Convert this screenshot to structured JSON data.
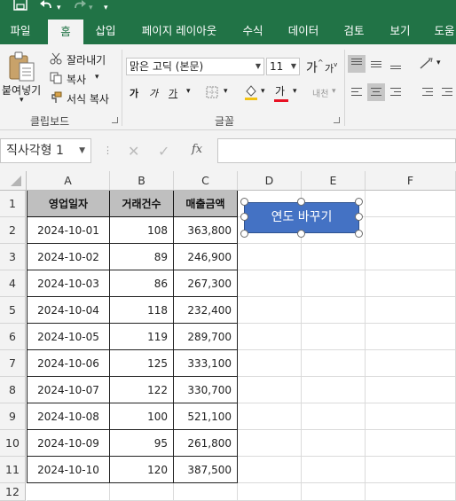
{
  "quick_access": {
    "save_icon": "save-icon",
    "undo_icon": "undo-icon",
    "redo_icon": "redo-icon",
    "customize_icon": "customize-quick-access-icon"
  },
  "tabs": [
    {
      "label": "파일",
      "active": false
    },
    {
      "label": "홈",
      "active": true
    },
    {
      "label": "삽입",
      "active": false
    },
    {
      "label": "페이지 레이아웃",
      "active": false
    },
    {
      "label": "수식",
      "active": false
    },
    {
      "label": "데이터",
      "active": false
    },
    {
      "label": "검토",
      "active": false
    },
    {
      "label": "보기",
      "active": false
    },
    {
      "label": "도움",
      "active": false
    }
  ],
  "clipboard": {
    "paste_label": "붙여넣기",
    "cut_label": "잘라내기",
    "copy_label": "복사",
    "format_painter_label": "서식 복사",
    "group_label": "클립보드"
  },
  "font": {
    "font_name": "맑은 고딕 (본문)",
    "font_size": "11",
    "grow_label": "가",
    "shrink_label": "가",
    "bold_label": "가",
    "italic_label": "가",
    "underline_label": "가",
    "font_color_label": "가",
    "phonetic_label": "내천",
    "group_label": "글꼴",
    "fill_color": "#f2c314",
    "font_color": "#e81123"
  },
  "formula_bar": {
    "name_box": "직사각형 1",
    "fx_label": "fx",
    "formula": ""
  },
  "sheet": {
    "columns": [
      "A",
      "B",
      "C",
      "D",
      "E",
      "F"
    ],
    "rows": [
      "1",
      "2",
      "3",
      "4",
      "5",
      "6",
      "7",
      "8",
      "9",
      "10",
      "11",
      "12"
    ],
    "headers": [
      "영업일자",
      "거래건수",
      "매출금액"
    ],
    "data": [
      [
        "2024-10-01",
        "108",
        "363,800"
      ],
      [
        "2024-10-02",
        "89",
        "246,900"
      ],
      [
        "2024-10-03",
        "86",
        "267,300"
      ],
      [
        "2024-10-04",
        "118",
        "232,400"
      ],
      [
        "2024-10-05",
        "119",
        "289,700"
      ],
      [
        "2024-10-06",
        "125",
        "333,100"
      ],
      [
        "2024-10-07",
        "122",
        "330,700"
      ],
      [
        "2024-10-08",
        "100",
        "521,100"
      ],
      [
        "2024-10-09",
        "95",
        "261,800"
      ],
      [
        "2024-10-10",
        "120",
        "387,500"
      ]
    ],
    "shape_label": "연도 바꾸기"
  },
  "colors": {
    "excel_green": "#217346",
    "shape_fill": "#4472c4",
    "header_fill": "#bfbfbf"
  }
}
